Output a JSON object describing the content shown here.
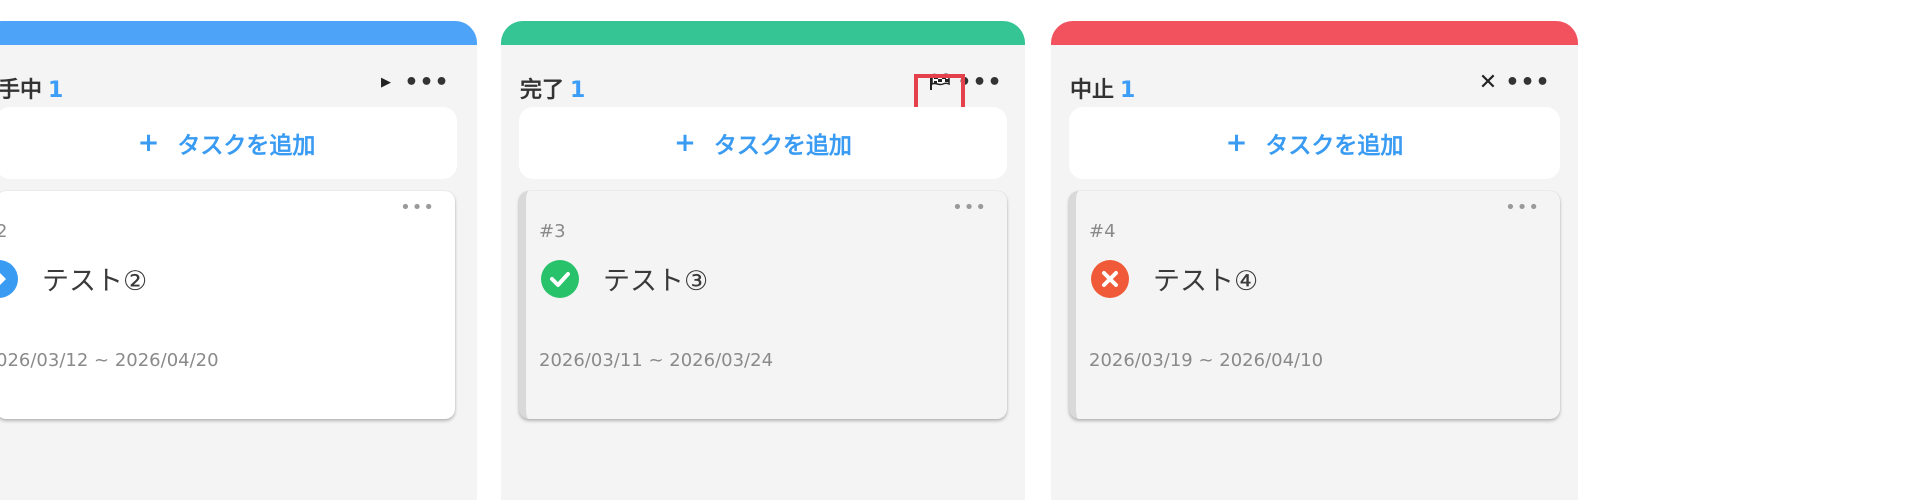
{
  "colors": {
    "in_progress": "#4da3f7",
    "done": "#35c493",
    "cancelled": "#f2525e",
    "accent_text": "#3a9bf2",
    "highlight": "#e5414d"
  },
  "columns": [
    {
      "title": "手中",
      "count": "1",
      "status_icon": "play-icon",
      "status_glyph": "▶",
      "more_glyph": "•••",
      "add_label": "タスクを追加",
      "add_plus": "+",
      "card": {
        "id": "2",
        "title": "テスト②",
        "dates": "026/03/12 ~ 2026/04/20",
        "status": "in-progress",
        "more_glyph": "•••"
      }
    },
    {
      "title": "完了",
      "count": "1",
      "status_icon": "checkered-flag-icon",
      "status_glyph": "🏁",
      "more_glyph": "•••",
      "add_label": "タスクを追加",
      "add_plus": "+",
      "card": {
        "id": "#3",
        "title": "テスト③",
        "dates": "2026/03/11 ~ 2026/03/24",
        "status": "done",
        "more_glyph": "•••"
      }
    },
    {
      "title": "中止",
      "count": "1",
      "status_icon": "close-icon",
      "status_glyph": "✕",
      "more_glyph": "•••",
      "add_label": "タスクを追加",
      "add_plus": "+",
      "card": {
        "id": "#4",
        "title": "テスト④",
        "dates": "2026/03/19 ~ 2026/04/10",
        "status": "cancelled",
        "more_glyph": "•••"
      }
    }
  ]
}
